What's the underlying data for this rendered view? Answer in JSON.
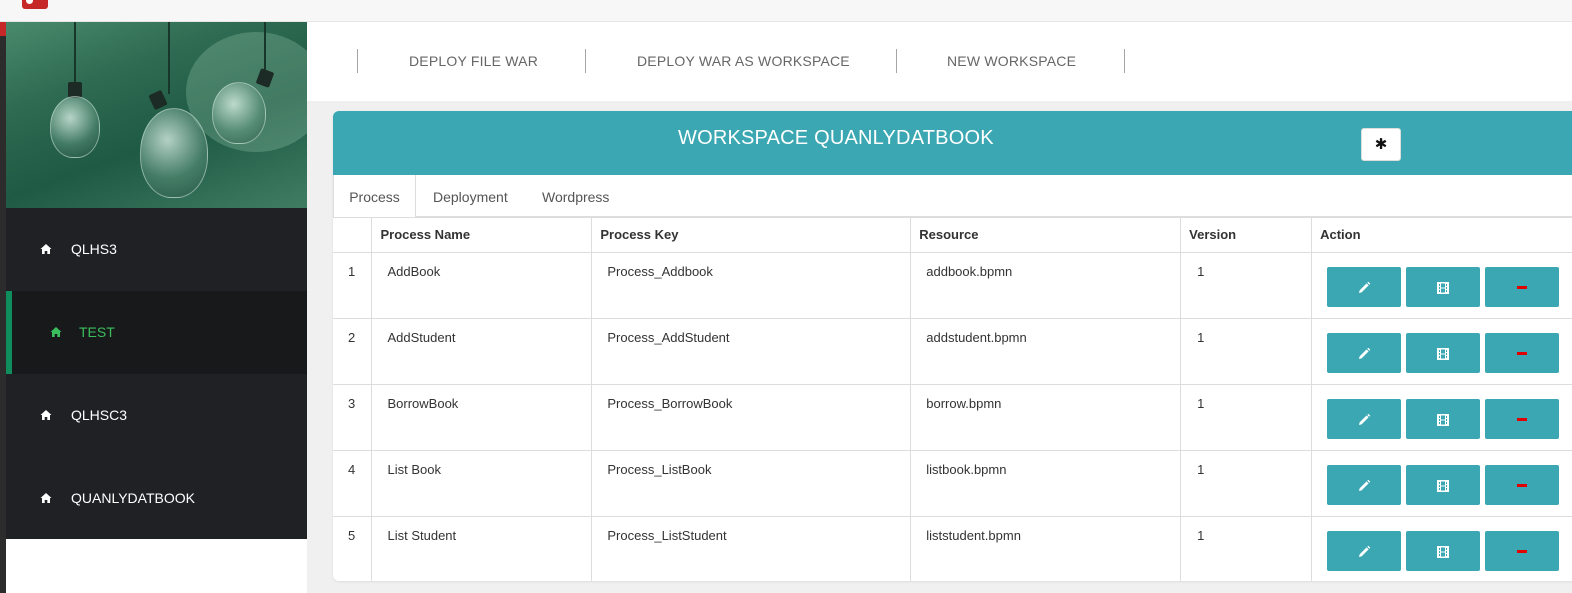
{
  "topnav": [
    "DEPLOY FILE WAR",
    "DEPLOY WAR AS WORKSPACE",
    "NEW WORKSPACE"
  ],
  "sidebar": {
    "items": [
      {
        "label": "QLHS3",
        "icon": "home-icon",
        "active": false
      },
      {
        "label": "TEST",
        "icon": "home-icon",
        "active": true
      },
      {
        "label": "QLHSC3",
        "icon": "home-icon",
        "active": false
      },
      {
        "label": "QUANLYDATBOOK",
        "icon": "home-icon",
        "active": false
      }
    ]
  },
  "workspace": {
    "title": "WORKSPACE QUANLYDATBOOK",
    "settings_icon": "asterisk-icon",
    "settings_glyph": "✱"
  },
  "tabs": [
    {
      "label": "Process",
      "active": true
    },
    {
      "label": "Deployment",
      "active": false
    },
    {
      "label": "Wordpress",
      "active": false
    }
  ],
  "table": {
    "columns": [
      "",
      "Process Name",
      "Process Key",
      "Resource",
      "Version",
      "Action"
    ],
    "rows": [
      {
        "no": "1",
        "name": "AddBook",
        "key": "Process_Addbook",
        "resource": "addbook.bpmn",
        "version": "1"
      },
      {
        "no": "2",
        "name": "AddStudent",
        "key": "Process_AddStudent",
        "resource": "addstudent.bpmn",
        "version": "1"
      },
      {
        "no": "3",
        "name": "BorrowBook",
        "key": "Process_BorrowBook",
        "resource": "borrow.bpmn",
        "version": "1"
      },
      {
        "no": "4",
        "name": "List Book",
        "key": "Process_ListBook",
        "resource": "listbook.bpmn",
        "version": "1"
      },
      {
        "no": "5",
        "name": "List Student",
        "key": "Process_ListStudent",
        "resource": "liststudent.bpmn",
        "version": "1"
      }
    ],
    "action_icons": [
      "pencil-icon",
      "film-icon",
      "minus-icon"
    ]
  },
  "colors": {
    "accent": "#3aa7b2",
    "sidebar_bg": "#1f2125",
    "active_nav": "#3bbf5e",
    "delete": "#e00000"
  }
}
